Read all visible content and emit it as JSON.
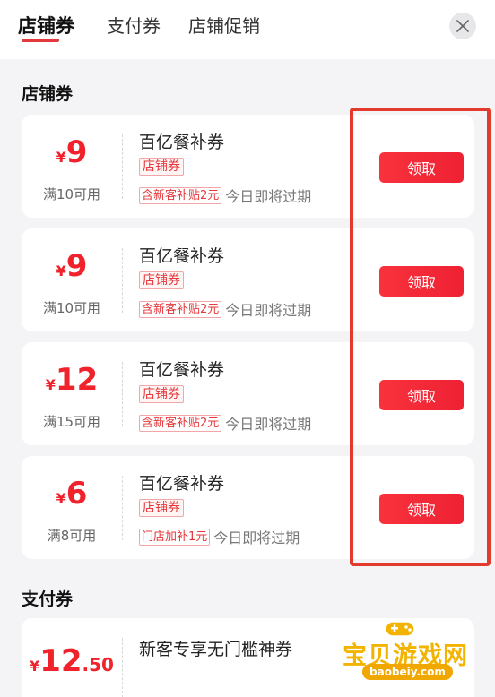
{
  "header": {
    "tabs": [
      {
        "label": "店铺券",
        "active": true
      },
      {
        "label": "支付券",
        "active": false
      },
      {
        "label": "店铺促销",
        "active": false
      }
    ],
    "close_icon": "close-icon",
    "accent_color": "#e4393c"
  },
  "sections": {
    "store_title": "店铺券",
    "payment_title": "支付券"
  },
  "store_coupons": [
    {
      "currency": "¥",
      "amount": "9",
      "condition": "满10可用",
      "name": "百亿餐补券",
      "tag": "店铺券",
      "subtag": "含新客补贴2元",
      "expire": "今日即将过期",
      "button": "领取"
    },
    {
      "currency": "¥",
      "amount": "9",
      "condition": "满10可用",
      "name": "百亿餐补券",
      "tag": "店铺券",
      "subtag": "含新客补贴2元",
      "expire": "今日即将过期",
      "button": "领取"
    },
    {
      "currency": "¥",
      "amount": "12",
      "condition": "满15可用",
      "name": "百亿餐补券",
      "tag": "店铺券",
      "subtag": "含新客补贴2元",
      "expire": "今日即将过期",
      "button": "领取"
    },
    {
      "currency": "¥",
      "amount": "6",
      "condition": "满8可用",
      "name": "百亿餐补券",
      "tag": "店铺券",
      "subtag": "门店加补1元",
      "expire": "今日即将过期",
      "button": "领取"
    }
  ],
  "payment_coupons": [
    {
      "currency": "¥",
      "amount": "12",
      "amount_decimal": ".50",
      "name": "新客专享无门槛神券"
    }
  ],
  "watermark": {
    "title": "宝贝游戏网",
    "domain": "baobeiy.com"
  }
}
